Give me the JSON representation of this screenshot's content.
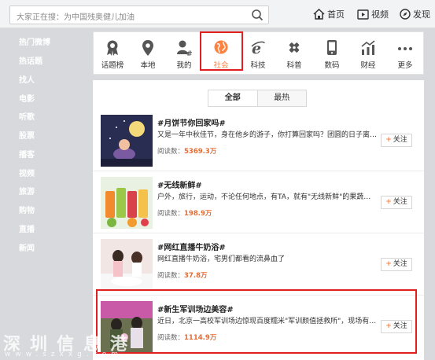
{
  "search": {
    "placeholder": "大家正在搜：为中国残奥健儿加油"
  },
  "top_nav": [
    {
      "label": "首页",
      "icon": "home-icon"
    },
    {
      "label": "视频",
      "icon": "video-icon"
    },
    {
      "label": "发现",
      "icon": "compass-icon"
    }
  ],
  "sidebar": {
    "items": [
      "热门微博",
      "热话题",
      "找人",
      "电影",
      "听歌",
      "股票",
      "播客",
      "视频",
      "旅游",
      "购物",
      "直播",
      "新闻"
    ]
  },
  "categories": [
    {
      "label": "话题榜",
      "icon": "badge-icon"
    },
    {
      "label": "本地",
      "icon": "location-pin-icon"
    },
    {
      "label": "我的",
      "icon": "user-hash-icon"
    },
    {
      "label": "社会",
      "icon": "globe-icon",
      "active": true
    },
    {
      "label": "科技",
      "icon": "browser-e-icon"
    },
    {
      "label": "科普",
      "icon": "tools-icon"
    },
    {
      "label": "数码",
      "icon": "phone-icon"
    },
    {
      "label": "财经",
      "icon": "chart-icon"
    },
    {
      "label": "更多",
      "icon": "more-dots-icon"
    }
  ],
  "tabs": [
    "全部",
    "最热"
  ],
  "topics": [
    {
      "title": "#月饼节你回家吗#",
      "desc": "又是一年中秋佳节，身在他乡的游子，你打算回家吗？团圆的日子离不开",
      "reads_label": "阅读数：",
      "reads": "5369.3万",
      "follow": "关注"
    },
    {
      "title": "#无线新鲜#",
      "desc": "户外，旅行，运动，不论任何地点，有TA，就有\"无线新鲜\"的果蔬汁！",
      "reads_label": "阅读数：",
      "reads": "198.9万",
      "follow": "关注"
    },
    {
      "title": "#网红直播牛奶浴#",
      "desc": "网红直播牛奶浴，宅男们都看的流鼻血了",
      "reads_label": "阅读数：",
      "reads": "37.8万",
      "follow": "关注"
    },
    {
      "title": "#新生军训场边美容#",
      "desc": "近日，北京一高校军训场边惊现百度糯米\"军训颜值拯救所\"，现场有专业",
      "reads_label": "阅读数：",
      "reads": "1114.9万",
      "follow": "关注"
    }
  ],
  "watermark": {
    "cn": "深圳信息港",
    "en": "www.szxxg.com"
  },
  "colors": {
    "accent": "#ff8140",
    "highlight": "#e02020"
  }
}
